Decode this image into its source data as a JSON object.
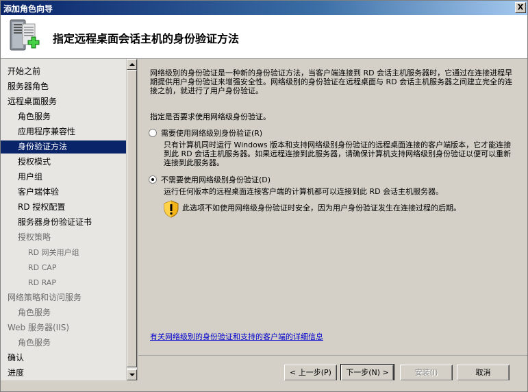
{
  "window": {
    "title": "添加角色向导",
    "close_glyph": "X"
  },
  "header": {
    "page_title": "指定远程桌面会话主机的身份验证方法",
    "icon": "server-add-icon"
  },
  "nav": {
    "items": [
      {
        "label": "开始之前",
        "level": 1,
        "state": "normal"
      },
      {
        "label": "服务器角色",
        "level": 1,
        "state": "normal"
      },
      {
        "label": "远程桌面服务",
        "level": 1,
        "state": "normal"
      },
      {
        "label": "角色服务",
        "level": 2,
        "state": "normal"
      },
      {
        "label": "应用程序兼容性",
        "level": 2,
        "state": "normal"
      },
      {
        "label": "身份验证方法",
        "level": 2,
        "state": "selected"
      },
      {
        "label": "授权模式",
        "level": 2,
        "state": "normal"
      },
      {
        "label": "用户组",
        "level": 2,
        "state": "normal"
      },
      {
        "label": "客户端体验",
        "level": 2,
        "state": "normal"
      },
      {
        "label": "RD 授权配置",
        "level": 2,
        "state": "normal"
      },
      {
        "label": "服务器身份验证证书",
        "level": 2,
        "state": "normal"
      },
      {
        "label": "授权策略",
        "level": 2,
        "state": "disabled"
      },
      {
        "label": "RD 网关用户组",
        "level": 3,
        "state": "disabled"
      },
      {
        "label": "RD CAP",
        "level": 3,
        "state": "disabled"
      },
      {
        "label": "RD RAP",
        "level": 3,
        "state": "disabled"
      },
      {
        "label": "网络策略和访问服务",
        "level": 1,
        "state": "disabled"
      },
      {
        "label": "角色服务",
        "level": 2,
        "state": "disabled"
      },
      {
        "label": "Web 服务器(IIS)",
        "level": 1,
        "state": "disabled"
      },
      {
        "label": "角色服务",
        "level": 2,
        "state": "disabled"
      },
      {
        "label": "确认",
        "level": 1,
        "state": "normal"
      },
      {
        "label": "进度",
        "level": 1,
        "state": "normal"
      }
    ]
  },
  "main": {
    "description": "网络级别的身份验证是一种新的身份验证方法，当客户端连接到 RD 会话主机服务器时，它通过在连接进程早期提供用户身份验证来增强安全性。网络级别的身份验证在远程桌面与 RD 会话主机服务器之间建立完全的连接之前，就进行了用户身份验证。",
    "question": "指定是否要求使用网络级身份验证。",
    "options": [
      {
        "label": "需要使用网络级别身份验证(R)",
        "selected": false,
        "description": "只有计算机同时运行 Windows 版本和支持网络级别身份验证的远程桌面连接的客户端版本，它才能连接到此 RD 会话主机服务器。如果远程连接到此服务器，请确保计算机支持网络级别身份验证以便可以重新连接到此服务器。"
      },
      {
        "label": "不需要使用网络级别身份验证(D)",
        "selected": true,
        "description": "运行任何版本的远程桌面连接客户端的计算机都可以连接到此 RD 会话主机服务器。"
      }
    ],
    "warning_icon": "shield-warning-icon",
    "warning": "此选项不如使用网络级身份验证时安全，因为用户身份验证发生在连接过程的后期。",
    "help_link": "有关网络级别的身份验证和支持的客户端的详细信息"
  },
  "buttons": {
    "back": "< 上一步(P)",
    "next": "下一步(N) >",
    "install": "安装(I)",
    "cancel": "取消"
  }
}
